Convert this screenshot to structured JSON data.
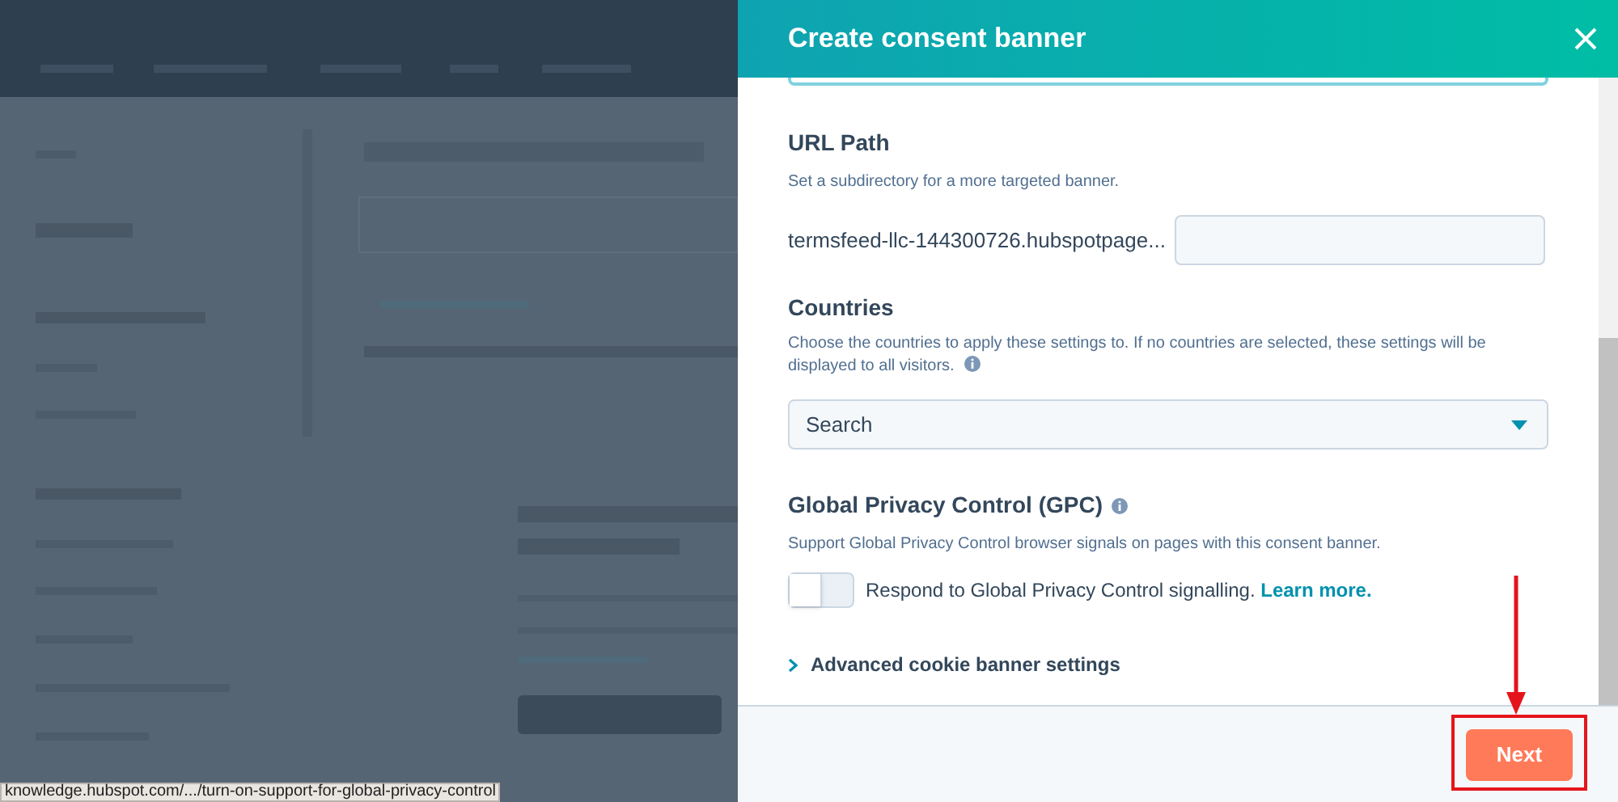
{
  "panel": {
    "title": "Create consent banner"
  },
  "url_path": {
    "title": "URL Path",
    "description": "Set a subdirectory for a more targeted banner.",
    "prefix": "termsfeed-llc-144300726.hubspotpage..."
  },
  "countries": {
    "title": "Countries",
    "description": "Choose the countries to apply these settings to. If no countries are selected, these settings will be displayed to all visitors.",
    "select": {
      "placeholder": "Search"
    }
  },
  "gpc": {
    "title": "Global Privacy Control (GPC)",
    "description": "Support Global Privacy Control browser signals on pages with this consent banner.",
    "toggle": {
      "on": false,
      "label": "Respond to Global Privacy Control signalling.",
      "link": "Learn more."
    }
  },
  "advanced": {
    "label": "Advanced cookie banner settings",
    "expanded": false
  },
  "footer": {
    "button": "Next"
  },
  "status_bar": {
    "url": "knowledge.hubspot.com/.../turn-on-support-for-global-privacy-control"
  }
}
